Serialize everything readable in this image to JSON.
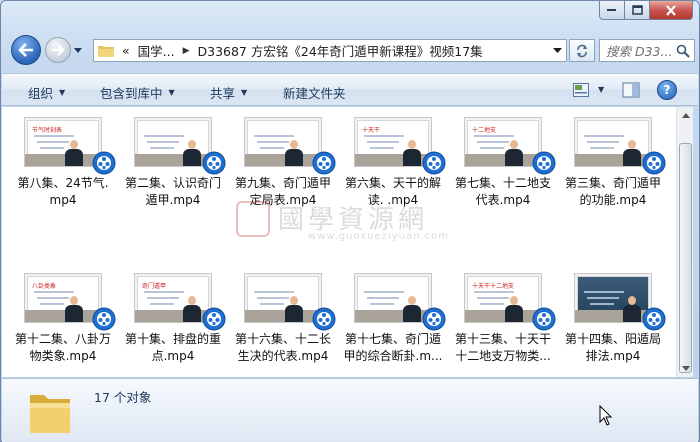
{
  "window": {
    "controls": {
      "minimize": "minimize",
      "maximize": "maximize",
      "close": "close"
    }
  },
  "address": {
    "prefix": "«",
    "segments": [
      "国学...",
      "D33687 方宏铭《24年奇门遁甲新课程》视频17集"
    ],
    "search_placeholder": "搜索 D33..."
  },
  "toolbar": {
    "organize": "组织",
    "include_library": "包含到库中",
    "share": "共享",
    "new_folder": "新建文件夹"
  },
  "files": [
    {
      "line1": "第八集、24节气.",
      "line2": "mp4",
      "board": "light",
      "board_text": "节气时刻表"
    },
    {
      "line1": "第二集、认识奇门",
      "line2": "遁甲.mp4",
      "board": "light",
      "board_text": ""
    },
    {
      "line1": "第九集、奇门遁甲",
      "line2": "定局表.mp4",
      "board": "light",
      "board_text": ""
    },
    {
      "line1": "第六集、天干的解",
      "line2": "读. .mp4",
      "board": "light",
      "board_text": "十天干"
    },
    {
      "line1": "第七集、十二地支",
      "line2": "代表.mp4",
      "board": "light",
      "board_text": "十二地支"
    },
    {
      "line1": "第三集、奇门遁甲",
      "line2": "的功能.mp4",
      "board": "light",
      "board_text": ""
    },
    {
      "line1": "第十二集、八卦万",
      "line2": "物类象.mp4",
      "board": "light",
      "board_text": "八卦类象"
    },
    {
      "line1": "第十集、排盘的重",
      "line2": "点.mp4",
      "board": "light",
      "board_text": "奇门遁甲"
    },
    {
      "line1": "第十六集、十二长",
      "line2": "生决的代表.mp4",
      "board": "light",
      "board_text": ""
    },
    {
      "line1": "第十七集、奇门遁",
      "line2": "甲的综合断卦.m...",
      "board": "light",
      "board_text": ""
    },
    {
      "line1": "第十三集、十天干",
      "line2": "十二地支万物类...",
      "board": "light",
      "board_text": "十天干十二地支"
    },
    {
      "line1": "第十四集、阳遁局",
      "line2": "排法.mp4",
      "board": "dark",
      "board_text": ""
    }
  ],
  "watermark": {
    "title": "國學資源網",
    "url": "www.guoxueziyuan.com"
  },
  "details": {
    "count": "17 个对象"
  },
  "colors": {
    "accent": "#1e395b",
    "badge_blue": "#1f6fd0"
  }
}
